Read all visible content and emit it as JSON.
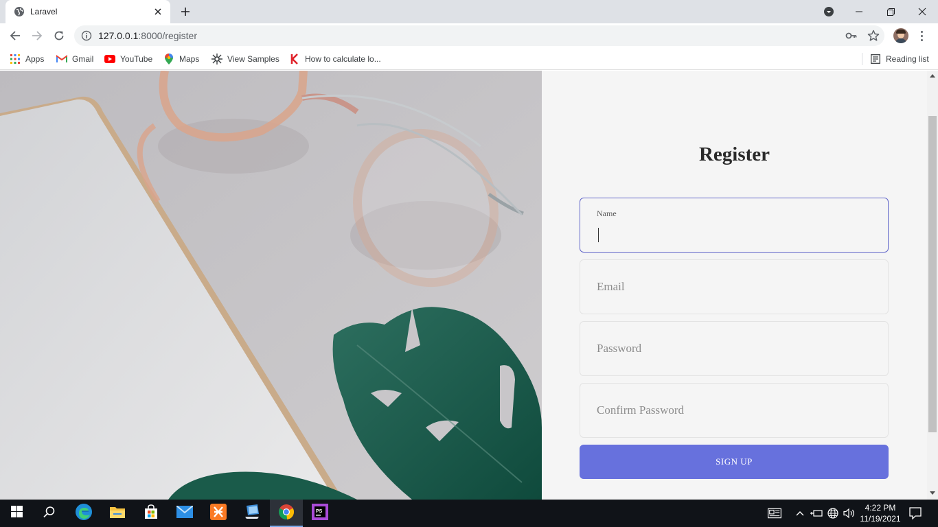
{
  "browser": {
    "tab_title": "Laravel",
    "url_host": "127.0.0.1",
    "url_path": ":8000/register",
    "reading_list_label": "Reading list"
  },
  "bookmarks": [
    {
      "label": "Apps",
      "icon": "apps-grid-icon"
    },
    {
      "label": "Gmail",
      "icon": "gmail-icon"
    },
    {
      "label": "YouTube",
      "icon": "youtube-icon"
    },
    {
      "label": "Maps",
      "icon": "maps-pin-icon"
    },
    {
      "label": "View Samples",
      "icon": "samples-icon"
    },
    {
      "label": "How to calculate lo...",
      "icon": "k-logo-icon"
    }
  ],
  "form": {
    "title": "Register",
    "name_label": "Name",
    "email_placeholder": "Email",
    "password_placeholder": "Password",
    "confirm_placeholder": "Confirm Password",
    "submit_label": "SIGN UP"
  },
  "taskbar": {
    "time": "4:22 PM",
    "date": "11/19/2021"
  },
  "colors": {
    "primary": "#6771dd",
    "focus_border": "#5f64c9",
    "panel_bg": "#f5f5f5",
    "taskbar_bg": "#101318"
  }
}
